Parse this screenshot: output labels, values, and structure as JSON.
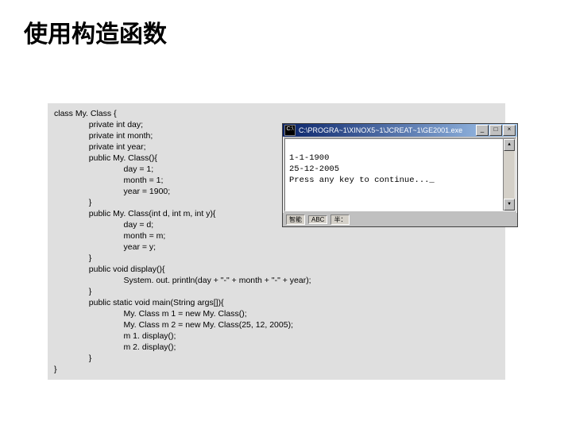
{
  "slide": {
    "title": "使用构造函数"
  },
  "code": {
    "text": "class My. Class {\n               private int day;\n               private int month;\n               private int year;\n               public My. Class(){\n                              day = 1;\n                              month = 1;\n                              year = 1900;\n               }\n               public My. Class(int d, int m, int y){\n                              day = d;\n                              month = m;\n                              year = y;\n               }\n               public void display(){\n                              System. out. println(day + \"-\" + month + \"-\" + year);\n               }\n               public static void main(String args[]){\n                              My. Class m 1 = new My. Class();\n                              My. Class m 2 = new My. Class(25, 12, 2005);\n                              m 1. display();\n                              m 2. display();\n               }\n}"
  },
  "console": {
    "title": "C:\\PROGRA~1\\XINOX5~1\\JCREAT~1\\GE2001.exe",
    "line1": "1-1-1900",
    "line2": "25-12-2005",
    "line3": "Press any key to continue..._",
    "minimize": "_",
    "maximize": "□",
    "close": "×",
    "scrollUp": "▲",
    "scrollDown": "▼",
    "ime1": "智能",
    "ime2": "ABC",
    "ime3": "半："
  }
}
